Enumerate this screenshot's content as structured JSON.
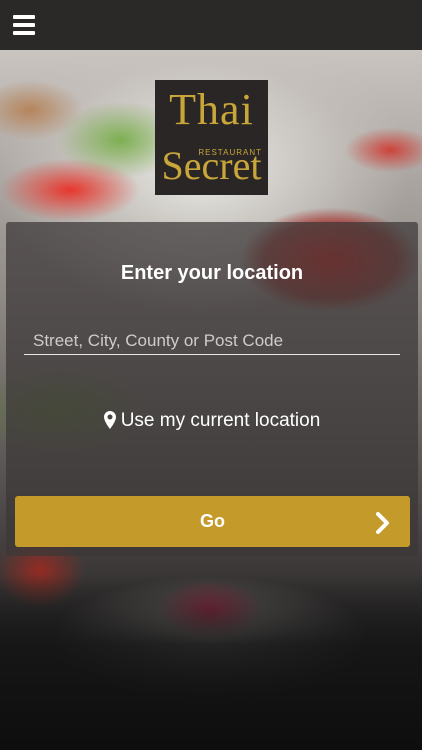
{
  "topbar": {
    "menu_icon": "hamburger-menu-icon"
  },
  "logo": {
    "line1": "Thai",
    "line2": "RESTAURANT",
    "line3": "Secret",
    "color": "#c9a63a"
  },
  "panel": {
    "heading": "Enter your location",
    "location_placeholder": "Street, City, County or Post Code",
    "location_value": "",
    "current_location_label": "Use my current location",
    "current_location_icon": "map-pin-icon"
  },
  "go_button": {
    "label": "Go",
    "icon": "chevron-right-icon",
    "color": "#c49a2b"
  }
}
